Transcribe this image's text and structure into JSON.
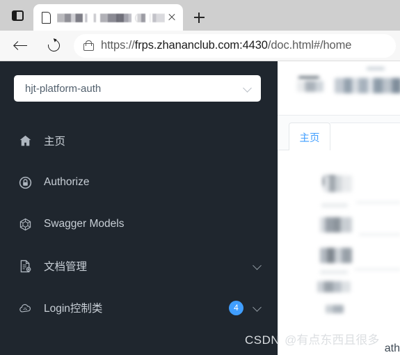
{
  "browser": {
    "vertical_tabs_icon": "panel-left-icon",
    "tab": {
      "favicon": "page-icon",
      "title_redacted": "▇▇▇▇ ▇ ▇▇▇▇▇▇ (▇▇ ▇▇)",
      "close_icon": "close-icon"
    },
    "new_tab_label": "+",
    "new_tab_icon": "plus-icon",
    "back_icon": "back-arrow-icon",
    "reload_icon": "reload-icon",
    "lock_icon": "lock-icon",
    "url": {
      "scheme": "https://",
      "host": "frps.zhananclub.com:4430",
      "path": "/doc.html#/home",
      "full": "https://frps.zhananclub.com:4430/doc.html#/home"
    }
  },
  "sidebar": {
    "service_select": {
      "value": "hjt-platform-auth",
      "placeholder": "hjt-platform-auth",
      "chevron_icon": "chevron-down-icon"
    },
    "items": [
      {
        "label": "主页",
        "icon": "home-icon",
        "badge": "",
        "chevron": false
      },
      {
        "label": "Authorize",
        "icon": "lock-circle-icon",
        "badge": "",
        "chevron": false
      },
      {
        "label": "Swagger Models",
        "icon": "cube-icon",
        "badge": "",
        "chevron": false
      },
      {
        "label": "文档管理",
        "icon": "document-gear-icon",
        "badge": "",
        "chevron": true
      },
      {
        "label": "Login控制类",
        "icon": "cloud-icon",
        "badge": "4",
        "chevron": true
      }
    ]
  },
  "content": {
    "tabs": [
      {
        "label": "主页",
        "active": true
      }
    ]
  },
  "watermark": {
    "brand": "CSDN",
    "user": "@有点东西且很多"
  },
  "corner": {
    "partial_text": "ath"
  },
  "colors": {
    "sidebar_bg": "#1f262e",
    "accent_blue": "#409eff",
    "badge_bg": "#409eff",
    "tabstrip_bg": "#cfcfcf",
    "navbar_bg": "#f7f7f7"
  }
}
